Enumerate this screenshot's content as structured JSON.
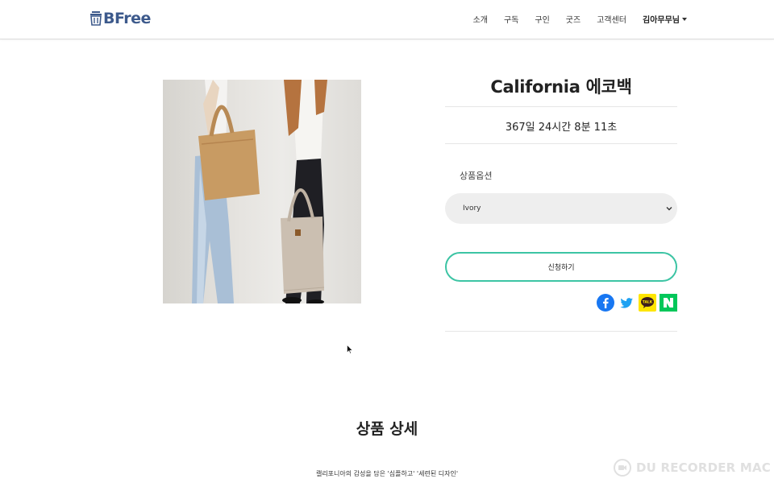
{
  "header": {
    "logo_text": "BFree",
    "nav": [
      "소개",
      "구독",
      "구인",
      "굿즈",
      "고객센터"
    ],
    "user_label": "김아무무님"
  },
  "product": {
    "title": "California 에코백",
    "countdown": "367일 24시간 8분 11초",
    "option_label": "상품옵션",
    "option_selected": "Ivory",
    "apply_label": "신청하기",
    "share_icons": [
      "facebook-icon",
      "twitter-icon",
      "kakaotalk-icon",
      "naver-icon"
    ]
  },
  "details": {
    "title": "상품 상세",
    "description": "캘리포니아의 감성을 담은 '심플하고' '세련된 디자인'"
  },
  "watermark": {
    "text": "DU RECORDER MAC"
  },
  "colors": {
    "brand": "#3d5a8c",
    "accent": "#3cc4a4",
    "select_bg": "#eeeeee"
  }
}
